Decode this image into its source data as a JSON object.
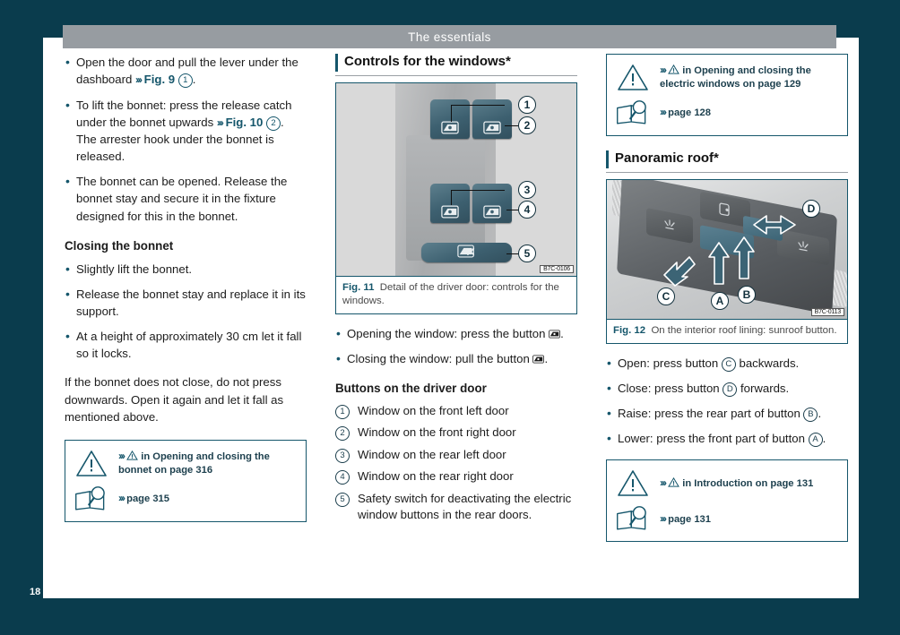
{
  "header": {
    "title": "The essentials"
  },
  "page": {
    "number": "18"
  },
  "left_column": {
    "bullets": [
      "Open the door and pull the lever under the dashboard",
      "To lift the bonnet: press the release catch under the bonnet upwards",
      "The bonnet can be opened. Release the bonnet stay and secure it in the fixture designed for this in the bonnet."
    ],
    "bullet1_ref": "Fig. 9",
    "bullet1_num": "1",
    "bullet1_tail": ".",
    "bullet2_ref": "Fig. 10",
    "bullet2_num": "2",
    "bullet2_tail": ". The arrester hook under the bonnet is released.",
    "heading_closing": "Closing the bonnet",
    "closing_bullets": [
      "Slightly lift the bonnet.",
      "Release the bonnet stay and replace it in its support.",
      "At a height of approximately 30 cm let it fall so it locks."
    ],
    "paragraph": "If the bonnet does not close, do not press downwards. Open it again and let it fall as mentioned above.",
    "note": {
      "warning_text": "in Opening and closing the bonnet on page 316",
      "page_text": "page 315",
      "chevron": "›››"
    }
  },
  "middle_column": {
    "section_title": "Controls for the windows*",
    "figure": {
      "label": "Fig. 11",
      "caption": "Detail of the driver door: controls for the windows.",
      "code": "B7C-0106",
      "callouts": [
        "1",
        "2",
        "3",
        "4",
        "5"
      ]
    },
    "bullets": [
      {
        "pre": "Opening the window: press the button ",
        "icon": "window-down-icon",
        "post": "."
      },
      {
        "pre": "Closing the window: pull the button ",
        "icon": "window-up-icon",
        "post": "."
      }
    ],
    "heading_buttons": "Buttons on the driver door",
    "numbered_items": [
      {
        "num": "1",
        "text": "Window on the front left door"
      },
      {
        "num": "2",
        "text": "Window on the front right door"
      },
      {
        "num": "3",
        "text": "Window on the rear left door"
      },
      {
        "num": "4",
        "text": "Window on the rear right door"
      },
      {
        "num": "5",
        "text": "Safety switch for deactivating the electric window buttons in the rear doors."
      }
    ]
  },
  "right_column": {
    "note_top": {
      "warning_text": "in Opening and closing the electric windows on page 129",
      "page_text": "page 128",
      "chevron": "›››"
    },
    "section_title": "Panoramic roof*",
    "figure": {
      "label": "Fig. 12",
      "caption": "On the interior roof lining: sunroof button.",
      "code": "B7C-0113",
      "callouts": [
        "A",
        "B",
        "C",
        "D"
      ]
    },
    "bullets": [
      {
        "pre": "Open: press button ",
        "mark": "C",
        "post": " backwards."
      },
      {
        "pre": "Close: press button ",
        "mark": "D",
        "post": " forwards."
      },
      {
        "pre": "Raise: press the rear part of button ",
        "mark": "B",
        "post": "."
      },
      {
        "pre": "Lower: press the front part of button ",
        "mark": "A",
        "post": "."
      }
    ],
    "note_bottom": {
      "warning_text": "in Introduction on page 131",
      "page_text": "page 131",
      "chevron": "›››"
    }
  },
  "colors": {
    "page_bg": "#0a3c4d",
    "header_bar": "#979ca1",
    "accent": "#15566b",
    "text": "#1c1c1c"
  }
}
